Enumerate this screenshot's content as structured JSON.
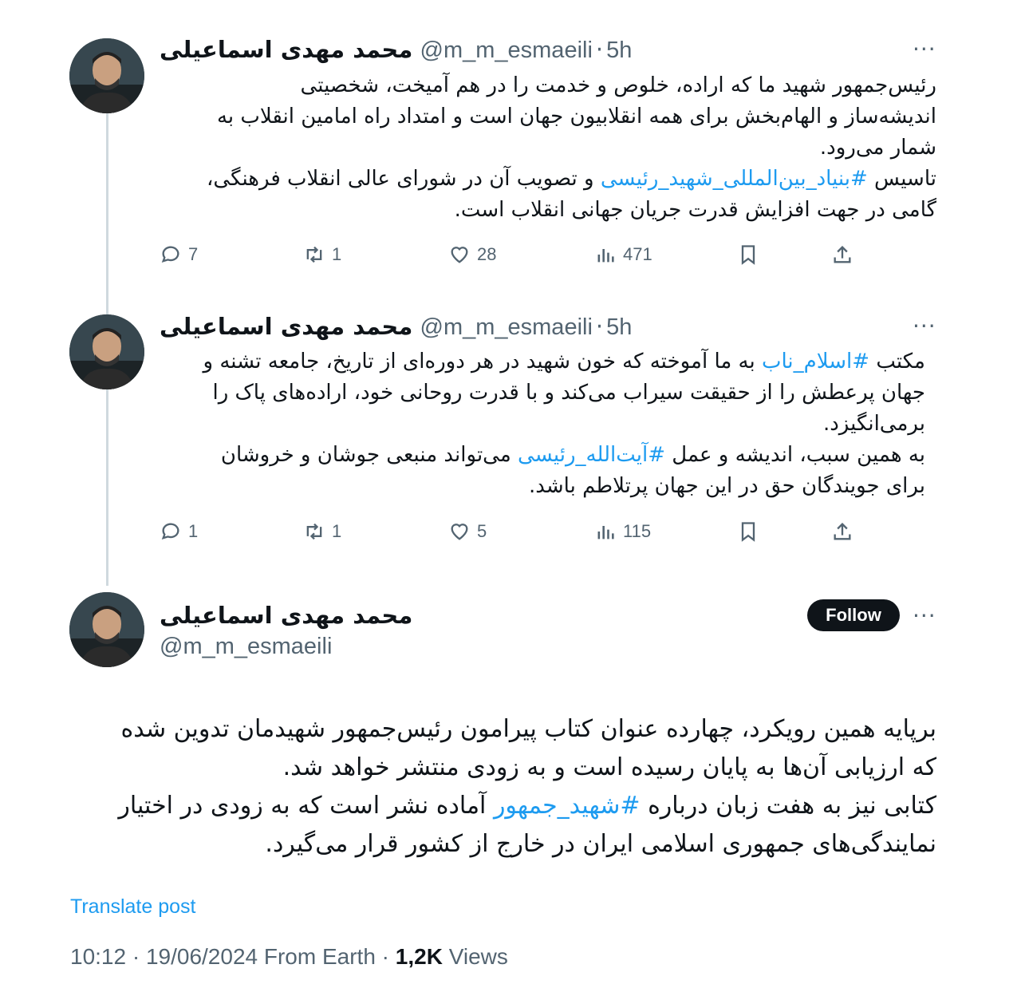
{
  "user": {
    "display_name": "محمد مهدی اسماعیلی",
    "handle": "@m_m_esmaeili"
  },
  "more_icon": "···",
  "tweets": [
    {
      "time": "5h",
      "text_before_tag": "رئیس‌جمهور شهید ما که اراده، خلوص و خدمت را در هم آمیخت، شخصیتی\nاندیشه‌ساز و الهام‌بخش برای همه انقلابیون جهان است و امتداد راه امامین انقلاب به\nشمار می‌رود.\nتاسیس ",
      "hashtag": "#بنیاد_بین‌المللی_شهید_رئیسی",
      "text_after_tag": " و تصویب آن در شورای عالی انقلاب فرهنگی،\nگامی در جهت افزایش قدرت جریان جهانی انقلاب است.",
      "replies": "7",
      "reposts": "1",
      "likes": "28",
      "views": "471"
    },
    {
      "time": "5h",
      "text_before_tag": "مکتب ",
      "hashtag": "#اسلام_ناب",
      "text_mid": " به ما آموخته که خون شهید در هر دوره‌ای از تاریخ، جامعه تشنه و\nجهان پرعطش را از حقیقت سیراب می‌کند و با قدرت روحانی خود، اراده‌های پاک را\nبرمی‌انگیزد.\nبه همین سبب، اندیشه و عمل ",
      "hashtag2": "#آیت‌الله_رئیسی",
      "text_after_tag": " می‌تواند منبعی جوشان و خروشان\nبرای جویندگان حق در این جهان پرتلاطم باشد.",
      "replies": "1",
      "reposts": "1",
      "likes": "5",
      "views": "115"
    }
  ],
  "main_tweet": {
    "follow_label": "Follow",
    "text_before_tag": "برپایه همین رویکرد، چهارده عنوان کتاب پیرامون رئیس‌جمهور شهیدمان تدوین شده\nکه ارزیابی آن‌ها به پایان رسیده است و به زودی منتشر خواهد شد.\nکتابی نیز به هفت زبان درباره ",
    "hashtag": "#شهید_جمهور",
    "text_after_tag": " آماده نشر است که به زودی در اختیار\nنمایندگی‌های جمهوری اسلامی ایران در خارج از کشور قرار می‌گیرد.",
    "translate_label": "Translate post",
    "timestamp": "10:12 · 19/06/2024 From Earth · ",
    "views_count": "1,2K",
    "views_label": " Views"
  },
  "colors": {
    "link": "#1d9bf0",
    "muted": "#536471",
    "text": "#0f1419",
    "thread": "#cfd9de"
  },
  "icons": [
    "reply-icon",
    "repost-icon",
    "like-icon",
    "views-icon",
    "bookmark-icon",
    "share-icon",
    "more-icon"
  ]
}
